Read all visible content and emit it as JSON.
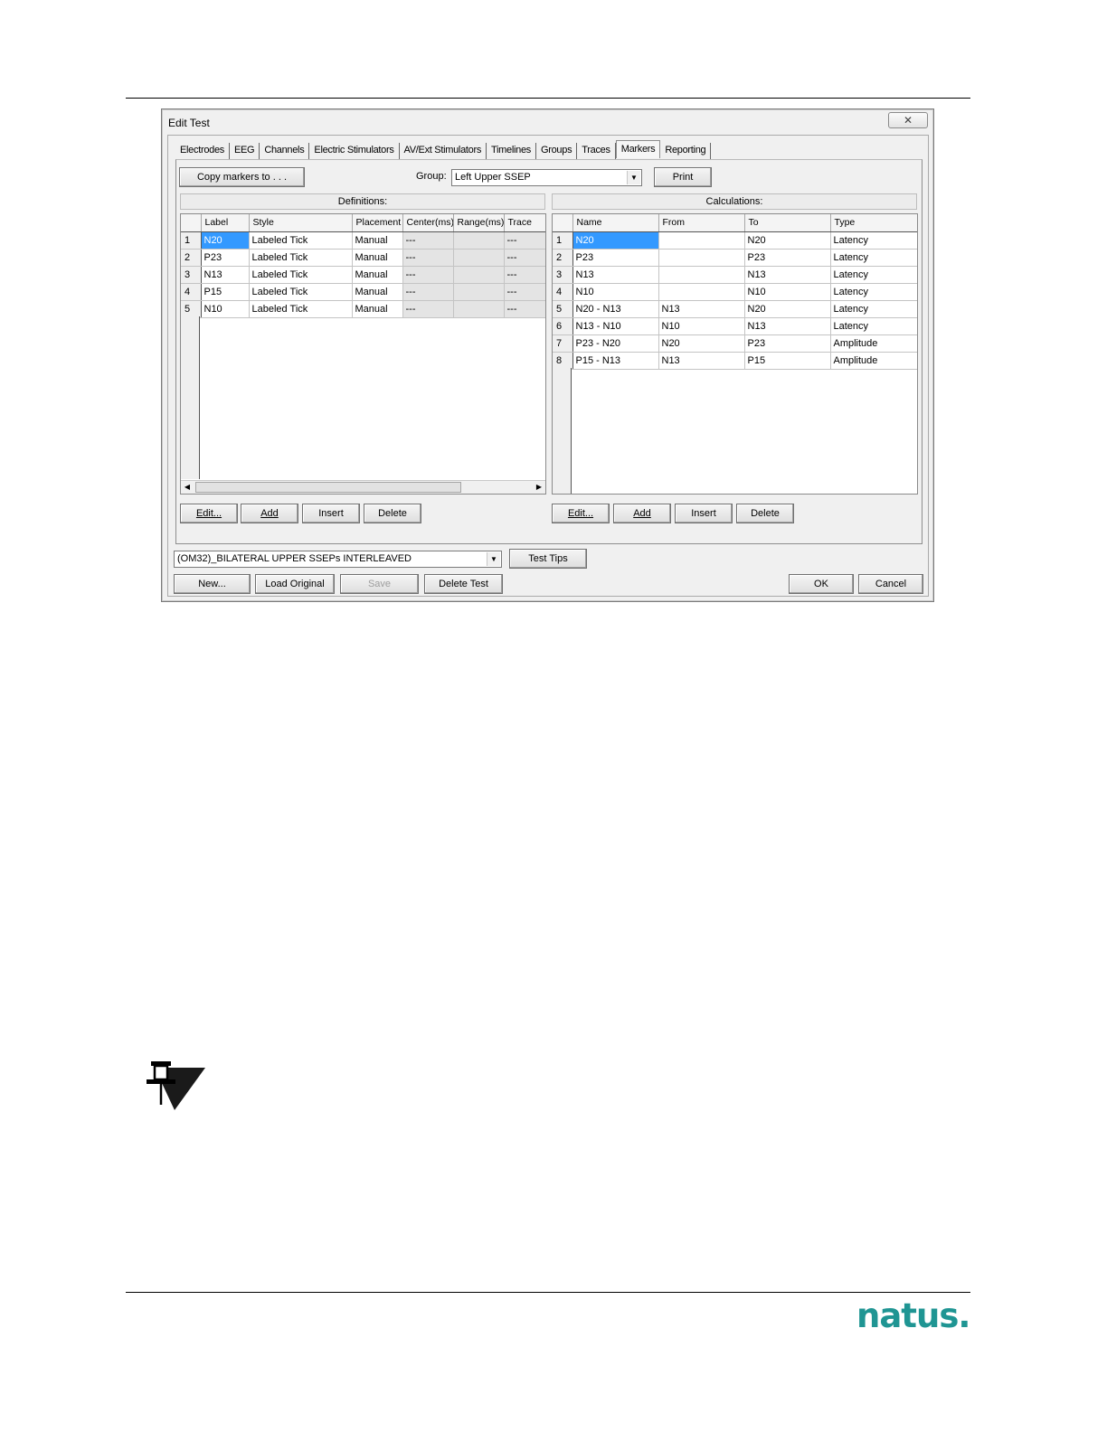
{
  "dialog": {
    "title": "Edit Test",
    "close_glyph": "✕"
  },
  "tabs": [
    {
      "label": "Electrodes"
    },
    {
      "label": "EEG"
    },
    {
      "label": "Channels"
    },
    {
      "label": "Electric Stimulators"
    },
    {
      "label": "AV/Ext Stimulators"
    },
    {
      "label": "Timelines"
    },
    {
      "label": "Groups"
    },
    {
      "label": "Traces"
    },
    {
      "label": "Markers"
    },
    {
      "label": "Reporting"
    }
  ],
  "markers": {
    "copy_button": "Copy markers to . . .",
    "group_label": "Group:",
    "group_value": "Left Upper SSEP",
    "print_button": "Print",
    "definitions_header": "Definitions:",
    "calculations_header": "Calculations:",
    "definitions_columns": [
      "Label",
      "Style",
      "Placement",
      "Center(ms)",
      "Range(ms)",
      "Trace"
    ],
    "definitions_rows": [
      {
        "n": "1",
        "label": "N20",
        "style": "Labeled Tick",
        "placement": "Manual",
        "center": "---",
        "range": "",
        "trace": "---"
      },
      {
        "n": "2",
        "label": "P23",
        "style": "Labeled Tick",
        "placement": "Manual",
        "center": "---",
        "range": "",
        "trace": "---"
      },
      {
        "n": "3",
        "label": "N13",
        "style": "Labeled Tick",
        "placement": "Manual",
        "center": "---",
        "range": "",
        "trace": "---"
      },
      {
        "n": "4",
        "label": "P15",
        "style": "Labeled Tick",
        "placement": "Manual",
        "center": "---",
        "range": "",
        "trace": "---"
      },
      {
        "n": "5",
        "label": "N10",
        "style": "Labeled Tick",
        "placement": "Manual",
        "center": "---",
        "range": "",
        "trace": "---"
      }
    ],
    "calculations_columns": [
      "Name",
      "From",
      "To",
      "Type"
    ],
    "calculations_rows": [
      {
        "n": "1",
        "name": "N20",
        "from": "",
        "to": "N20",
        "type": "Latency"
      },
      {
        "n": "2",
        "name": "P23",
        "from": "",
        "to": "P23",
        "type": "Latency"
      },
      {
        "n": "3",
        "name": "N13",
        "from": "",
        "to": "N13",
        "type": "Latency"
      },
      {
        "n": "4",
        "name": "N10",
        "from": "",
        "to": "N10",
        "type": "Latency"
      },
      {
        "n": "5",
        "name": "N20 - N13",
        "from": "N13",
        "to": "N20",
        "type": "Latency"
      },
      {
        "n": "6",
        "name": "N13 - N10",
        "from": "N10",
        "to": "N13",
        "type": "Latency"
      },
      {
        "n": "7",
        "name": "P23 - N20",
        "from": "N20",
        "to": "P23",
        "type": "Amplitude"
      },
      {
        "n": "8",
        "name": "P15 - N13",
        "from": "N13",
        "to": "P15",
        "type": "Amplitude"
      }
    ],
    "def_buttons": {
      "edit": "Edit...",
      "add": "Add",
      "insert": "Insert",
      "delete": "Delete"
    },
    "calc_buttons": {
      "edit": "Edit...",
      "add": "Add",
      "insert": "Insert",
      "delete": "Delete"
    }
  },
  "footer": {
    "test_select": "(OM32)_BILATERAL UPPER SSEPs INTERLEAVED",
    "test_tips": "Test Tips",
    "new": "New...",
    "load_original": "Load Original",
    "save": "Save",
    "delete_test": "Delete Test",
    "ok": "OK",
    "cancel": "Cancel"
  },
  "brand": {
    "logo_text": "natus",
    "logo_dot": ".",
    "color": "#1f9593"
  },
  "icons": {
    "note": "pushpin-note-icon"
  }
}
